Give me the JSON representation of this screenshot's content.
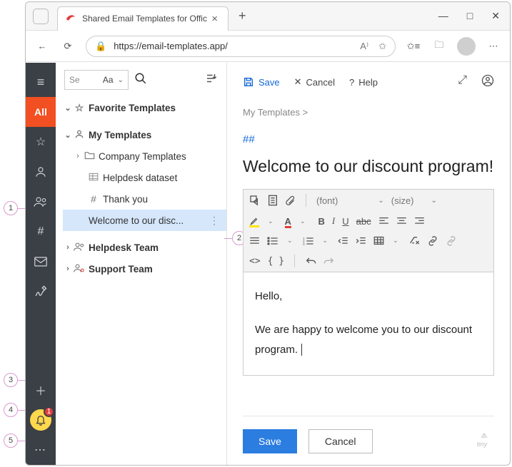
{
  "browser": {
    "tab_title": "Shared Email Templates for Offic",
    "url": "https://email-templates.app/"
  },
  "leftbar": {
    "all_label": "All",
    "bell_badge": "1"
  },
  "tree": {
    "search_placeholder": "Se",
    "aa_label": "Aa",
    "favorite_label": "Favorite Templates",
    "my_templates_label": "My Templates",
    "company_label": "Company Templates",
    "helpdesk_dataset_label": "Helpdesk dataset",
    "thankyou_label": "Thank you",
    "welcome_label": "Welcome to our disc...",
    "helpdesk_team_label": "Helpdesk Team",
    "support_team_label": "Support Team"
  },
  "editor": {
    "save_label": "Save",
    "cancel_label": "Cancel",
    "help_label": "Help",
    "breadcrumb": "My Templates  >",
    "hashes": "##",
    "title": "Welcome to our discount program!",
    "font_label": "(font)",
    "size_label": "(size)",
    "body_line1": "Hello,",
    "body_line2": "We are happy to welcome you to our discount program.",
    "footer_save": "Save",
    "footer_cancel": "Cancel",
    "tiny": "tiny"
  },
  "callouts": {
    "c1": "1",
    "c2": "2",
    "c3": "3",
    "c4": "4",
    "c5": "5"
  }
}
